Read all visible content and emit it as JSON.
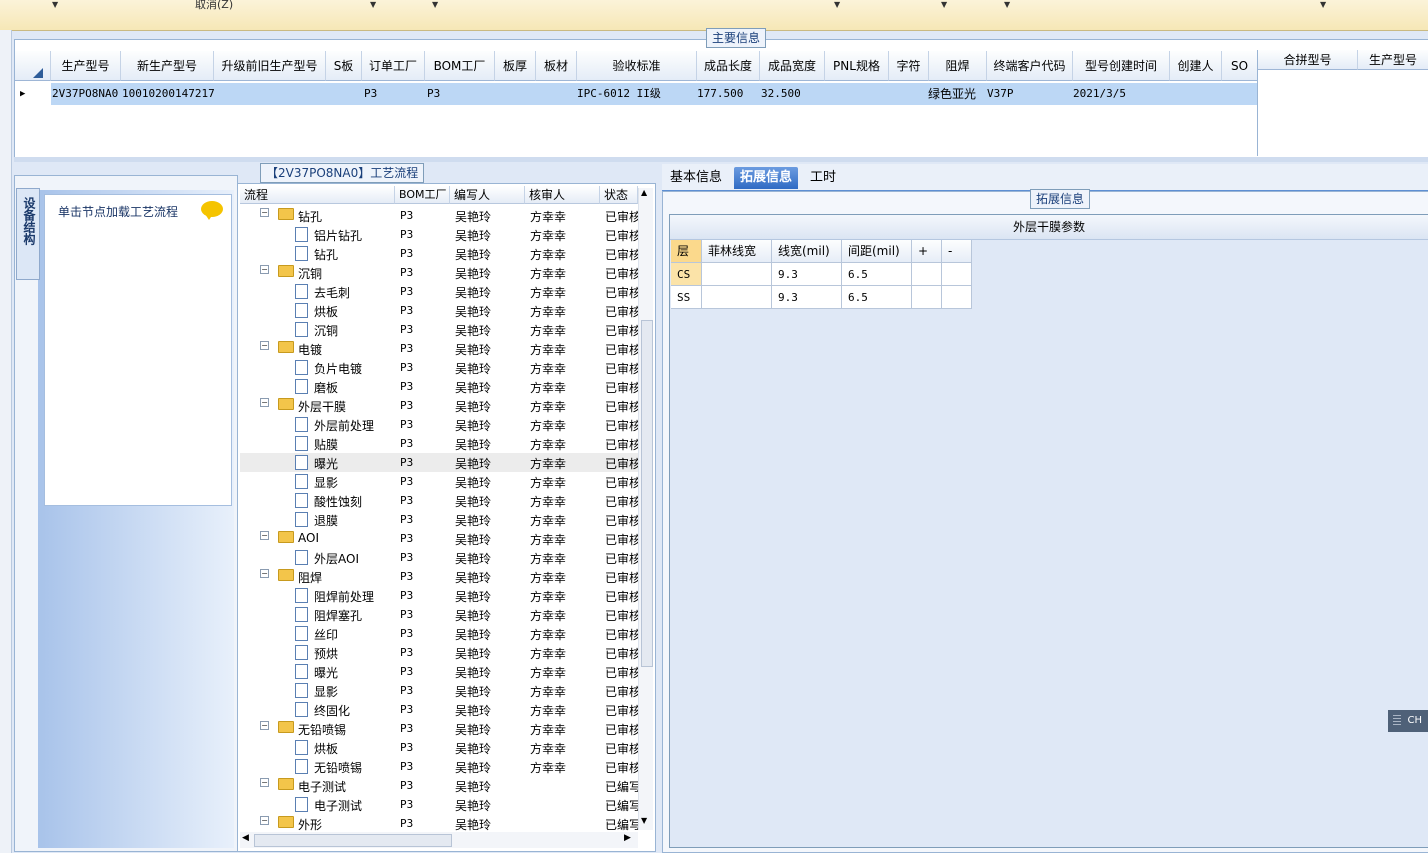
{
  "toolbar": {
    "cancel_label": "取消(Z)"
  },
  "main_info": {
    "legend": "主要信息",
    "columns": [
      "生产型号",
      "新生产型号",
      "升级前旧生产型号",
      "S板",
      "订单工厂",
      "BOM工厂",
      "板厚",
      "板材",
      "验收标准",
      "成品长度",
      "成品宽度",
      "PNL规格",
      "字符",
      "阻焊",
      "终端客户代码",
      "型号创建时间",
      "创建人",
      "SO"
    ],
    "row": {
      "model": "2V37PO8NA0",
      "new_model": "10010200147217",
      "order_factory": "P3",
      "bom_factory": "P3",
      "standard": "IPC-6012 II级",
      "length": "177.500",
      "width": "32.500",
      "solder_mask": "绿色亚光",
      "customer_code": "V37P",
      "created": "2021/3/5"
    },
    "right_columns": [
      "合拼型号",
      "生产型号"
    ]
  },
  "left_panel": {
    "vertical_tab": "设备结构",
    "load_hint": "单击节点加载工艺流程"
  },
  "process_tree": {
    "title": "【2V37PO8NA0】工艺流程",
    "columns": [
      "流程",
      "BOM工厂",
      "编写人",
      "核审人",
      "状态"
    ],
    "rows": [
      {
        "name": "钻孔",
        "type": "folder",
        "factory": "P3",
        "writer": "吴艳玲",
        "reviewer": "方幸幸",
        "status": "已审核"
      },
      {
        "name": "铝片钻孔",
        "type": "doc",
        "factory": "P3",
        "writer": "吴艳玲",
        "reviewer": "方幸幸",
        "status": "已审核"
      },
      {
        "name": "钻孔",
        "type": "doc",
        "factory": "P3",
        "writer": "吴艳玲",
        "reviewer": "方幸幸",
        "status": "已审核"
      },
      {
        "name": "沉铜",
        "type": "folder",
        "factory": "P3",
        "writer": "吴艳玲",
        "reviewer": "方幸幸",
        "status": "已审核"
      },
      {
        "name": "去毛刺",
        "type": "doc",
        "factory": "P3",
        "writer": "吴艳玲",
        "reviewer": "方幸幸",
        "status": "已审核"
      },
      {
        "name": "烘板",
        "type": "doc",
        "factory": "P3",
        "writer": "吴艳玲",
        "reviewer": "方幸幸",
        "status": "已审核"
      },
      {
        "name": "沉铜",
        "type": "doc",
        "factory": "P3",
        "writer": "吴艳玲",
        "reviewer": "方幸幸",
        "status": "已审核"
      },
      {
        "name": "电镀",
        "type": "folder",
        "factory": "P3",
        "writer": "吴艳玲",
        "reviewer": "方幸幸",
        "status": "已审核"
      },
      {
        "name": "负片电镀",
        "type": "doc",
        "factory": "P3",
        "writer": "吴艳玲",
        "reviewer": "方幸幸",
        "status": "已审核"
      },
      {
        "name": "磨板",
        "type": "doc",
        "factory": "P3",
        "writer": "吴艳玲",
        "reviewer": "方幸幸",
        "status": "已审核"
      },
      {
        "name": "外层干膜",
        "type": "folder",
        "factory": "P3",
        "writer": "吴艳玲",
        "reviewer": "方幸幸",
        "status": "已审核"
      },
      {
        "name": "外层前处理",
        "type": "doc",
        "factory": "P3",
        "writer": "吴艳玲",
        "reviewer": "方幸幸",
        "status": "已审核"
      },
      {
        "name": "贴膜",
        "type": "doc",
        "factory": "P3",
        "writer": "吴艳玲",
        "reviewer": "方幸幸",
        "status": "已审核"
      },
      {
        "name": "曝光",
        "type": "doc",
        "factory": "P3",
        "writer": "吴艳玲",
        "reviewer": "方幸幸",
        "status": "已审核",
        "selected": true
      },
      {
        "name": "显影",
        "type": "doc",
        "factory": "P3",
        "writer": "吴艳玲",
        "reviewer": "方幸幸",
        "status": "已审核"
      },
      {
        "name": "酸性蚀刻",
        "type": "doc",
        "factory": "P3",
        "writer": "吴艳玲",
        "reviewer": "方幸幸",
        "status": "已审核"
      },
      {
        "name": "退膜",
        "type": "doc",
        "factory": "P3",
        "writer": "吴艳玲",
        "reviewer": "方幸幸",
        "status": "已审核"
      },
      {
        "name": "AOI",
        "type": "folder",
        "factory": "P3",
        "writer": "吴艳玲",
        "reviewer": "方幸幸",
        "status": "已审核"
      },
      {
        "name": "外层AOI",
        "type": "doc",
        "factory": "P3",
        "writer": "吴艳玲",
        "reviewer": "方幸幸",
        "status": "已审核"
      },
      {
        "name": "阻焊",
        "type": "folder",
        "factory": "P3",
        "writer": "吴艳玲",
        "reviewer": "方幸幸",
        "status": "已审核"
      },
      {
        "name": "阻焊前处理",
        "type": "doc",
        "factory": "P3",
        "writer": "吴艳玲",
        "reviewer": "方幸幸",
        "status": "已审核"
      },
      {
        "name": "阻焊塞孔",
        "type": "doc",
        "factory": "P3",
        "writer": "吴艳玲",
        "reviewer": "方幸幸",
        "status": "已审核"
      },
      {
        "name": "丝印",
        "type": "doc",
        "factory": "P3",
        "writer": "吴艳玲",
        "reviewer": "方幸幸",
        "status": "已审核"
      },
      {
        "name": "预烘",
        "type": "doc",
        "factory": "P3",
        "writer": "吴艳玲",
        "reviewer": "方幸幸",
        "status": "已审核"
      },
      {
        "name": "曝光",
        "type": "doc",
        "factory": "P3",
        "writer": "吴艳玲",
        "reviewer": "方幸幸",
        "status": "已审核"
      },
      {
        "name": "显影",
        "type": "doc",
        "factory": "P3",
        "writer": "吴艳玲",
        "reviewer": "方幸幸",
        "status": "已审核"
      },
      {
        "name": "终固化",
        "type": "doc",
        "factory": "P3",
        "writer": "吴艳玲",
        "reviewer": "方幸幸",
        "status": "已审核"
      },
      {
        "name": "无铅喷锡",
        "type": "folder",
        "factory": "P3",
        "writer": "吴艳玲",
        "reviewer": "方幸幸",
        "status": "已审核"
      },
      {
        "name": "烘板",
        "type": "doc",
        "factory": "P3",
        "writer": "吴艳玲",
        "reviewer": "方幸幸",
        "status": "已审核"
      },
      {
        "name": "无铅喷锡",
        "type": "doc",
        "factory": "P3",
        "writer": "吴艳玲",
        "reviewer": "方幸幸",
        "status": "已审核"
      },
      {
        "name": "电子测试",
        "type": "folder",
        "factory": "P3",
        "writer": "吴艳玲",
        "reviewer": "",
        "status": "已编写"
      },
      {
        "name": "电子测试",
        "type": "doc",
        "factory": "P3",
        "writer": "吴艳玲",
        "reviewer": "",
        "status": "已编写"
      },
      {
        "name": "外形",
        "type": "folder",
        "factory": "P3",
        "writer": "吴艳玲",
        "reviewer": "",
        "status": "已编写"
      }
    ]
  },
  "right_tabs": {
    "basic": "基本信息",
    "extended": "拓展信息",
    "hours": "工时"
  },
  "extended": {
    "legend": "拓展信息",
    "header": "外层干膜参数",
    "columns": [
      "层",
      "菲林线宽",
      "线宽(mil)",
      "间距(mil)",
      "+",
      "-"
    ],
    "rows": [
      {
        "layer": "CS",
        "film": "",
        "width": "9.3",
        "spacing": "6.5"
      },
      {
        "layer": "SS",
        "film": "",
        "width": "9.3",
        "spacing": "6.5"
      }
    ]
  },
  "ime_badge": "CH"
}
